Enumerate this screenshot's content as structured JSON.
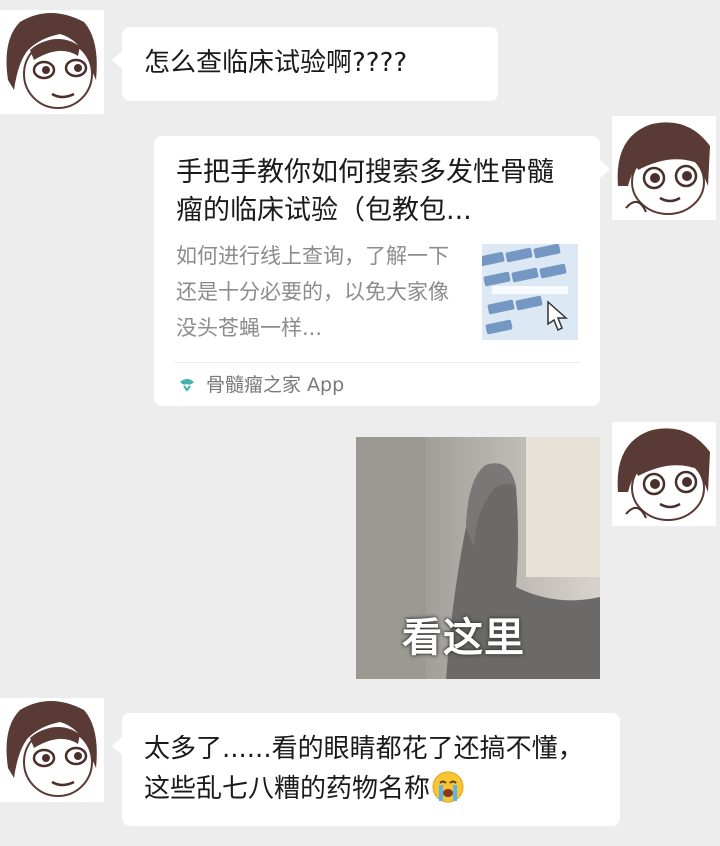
{
  "messages": {
    "m1": {
      "text": "怎么查临床试验啊????"
    },
    "m2": {
      "title": "手把手教你如何搜索多发性骨髓瘤的临床试验（包教包...",
      "description": "如何进行线上查询，了解一下还是十分必要的，以免大家像没头苍蝇一样...",
      "source": "骨髓瘤之家 App"
    },
    "m3": {
      "sticker_caption": "看这里"
    },
    "m4": {
      "text": "太多了......看的眼睛都花了还搞不懂，这些乱七八糟的药物名称"
    }
  },
  "icons": {
    "source_app": "share-app-icon",
    "emoji": "crying-face-icon"
  },
  "colors": {
    "background": "#ededed",
    "bubble": "#ffffff",
    "source_icon": "#3fb3a6"
  }
}
